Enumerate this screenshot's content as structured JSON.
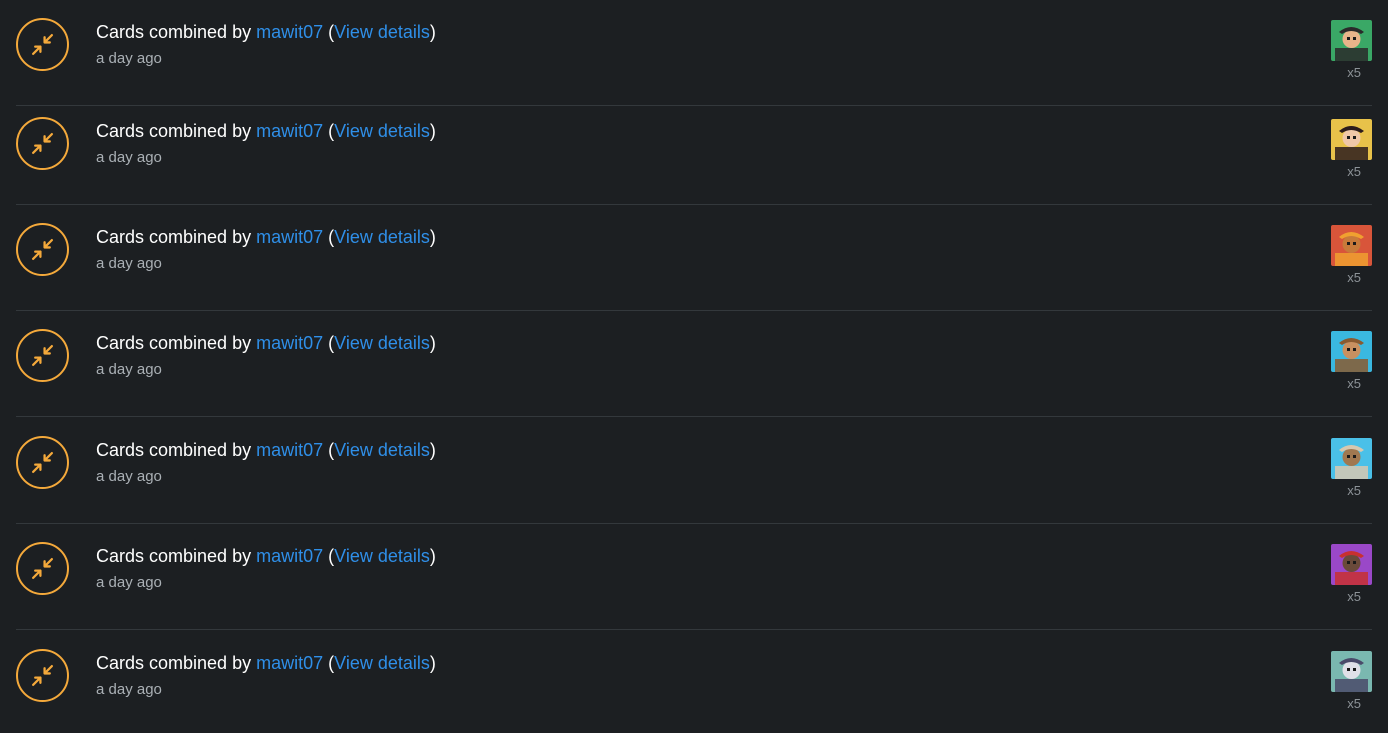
{
  "activity": {
    "items": [
      {
        "prefix": "Cards combined by",
        "user": "mawit07",
        "open_paren": "(",
        "details_label": "View details",
        "close_paren": ")",
        "time": "a day ago",
        "quantity": "x5",
        "icon": "combine-arrows-icon",
        "card_colors": {
          "bg": "#3aa866",
          "accent": "#2a2a2a",
          "skin": "#e8b48a"
        }
      },
      {
        "prefix": "Cards combined by",
        "user": "mawit07",
        "open_paren": "(",
        "details_label": "View details",
        "close_paren": ")",
        "time": "a day ago",
        "quantity": "x5",
        "icon": "combine-arrows-icon",
        "card_colors": {
          "bg": "#e8c24a",
          "accent": "#2b1c1c",
          "skin": "#f0c8a8"
        }
      },
      {
        "prefix": "Cards combined by",
        "user": "mawit07",
        "open_paren": "(",
        "details_label": "View details",
        "close_paren": ")",
        "time": "a day ago",
        "quantity": "x5",
        "icon": "combine-arrows-icon",
        "card_colors": {
          "bg": "#d8553a",
          "accent": "#f0a030",
          "skin": "#c87a3a"
        }
      },
      {
        "prefix": "Cards combined by",
        "user": "mawit07",
        "open_paren": "(",
        "details_label": "View details",
        "close_paren": ")",
        "time": "a day ago",
        "quantity": "x5",
        "icon": "combine-arrows-icon",
        "card_colors": {
          "bg": "#3ab8e0",
          "accent": "#8a5a30",
          "skin": "#c89060"
        }
      },
      {
        "prefix": "Cards combined by",
        "user": "mawit07",
        "open_paren": "(",
        "details_label": "View details",
        "close_paren": ")",
        "time": "a day ago",
        "quantity": "x5",
        "icon": "combine-arrows-icon",
        "card_colors": {
          "bg": "#4ac0e8",
          "accent": "#d8c8b0",
          "skin": "#a07850"
        }
      },
      {
        "prefix": "Cards combined by",
        "user": "mawit07",
        "open_paren": "(",
        "details_label": "View details",
        "close_paren": ")",
        "time": "a day ago",
        "quantity": "x5",
        "icon": "combine-arrows-icon",
        "card_colors": {
          "bg": "#9a48c8",
          "accent": "#c83030",
          "skin": "#6a4a3a"
        }
      },
      {
        "prefix": "Cards combined by",
        "user": "mawit07",
        "open_paren": "(",
        "details_label": "View details",
        "close_paren": ")",
        "time": "a day ago",
        "quantity": "x5",
        "icon": "combine-arrows-icon",
        "card_colors": {
          "bg": "#7ab8b0",
          "accent": "#4a4a6a",
          "skin": "#e0e0e8"
        }
      }
    ]
  },
  "colors": {
    "background": "#1c1f22",
    "divider": "#33383c",
    "accent_orange": "#f4a93b",
    "link_blue": "#2f8fe8",
    "muted_text": "#aab0b5"
  }
}
